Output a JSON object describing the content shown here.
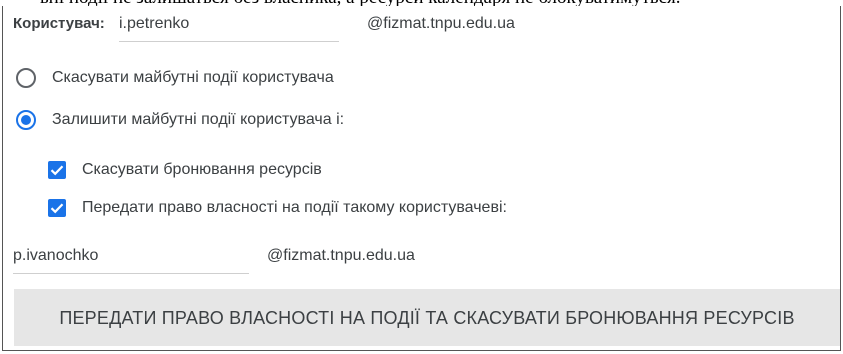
{
  "header_cut_text": "ьні події не залишаться без власника, а ресурси календаря не блокуватимуться.",
  "user": {
    "label": "Користувач:",
    "value": "i.petrenko",
    "domain": "@fizmat.tnpu.edu.ua"
  },
  "options": {
    "cancel_label": "Скасувати майбутні події користувача",
    "cancel_selected": false,
    "keep_label": "Залишити майбутні події користувача і:",
    "keep_selected": true
  },
  "checks": {
    "cancel_bookings_label": "Скасувати бронювання ресурсів",
    "cancel_bookings_checked": true,
    "transfer_label": "Передати право власності на події такому користувачеві:",
    "transfer_checked": true
  },
  "transfer_user": {
    "value": "p.ivanochko",
    "domain": "@fizmat.tnpu.edu.ua"
  },
  "action_button": "ПЕРЕДАТИ ПРАВО ВЛАСНОСТІ НА ПОДІЇ ТА СКАСУВАТИ БРОНЮВАННЯ РЕСУРСІВ",
  "colors": {
    "accent": "#1a73e8",
    "text": "#3c4043",
    "button_bg": "#e6e6e6"
  }
}
